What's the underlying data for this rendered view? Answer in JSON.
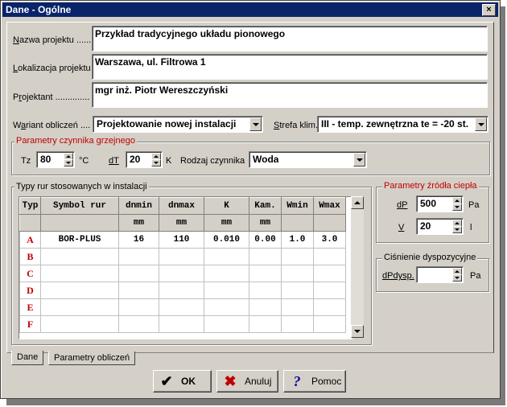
{
  "window": {
    "title": "Dane - Ogólne",
    "close": "×"
  },
  "fields": {
    "nazwa": {
      "label_u": "N",
      "label_rest": "azwa projektu ......",
      "value": "Przykład tradycyjnego układu pionowego"
    },
    "lokalizacja": {
      "label_u": "L",
      "label_rest": "okalizacja projektu",
      "value": "Warszawa, ul. Filtrowa 1"
    },
    "projektant": {
      "label_pre": "P",
      "label_u": "r",
      "label_rest": "ojektant ..............",
      "value": "mgr inż. Piotr Wereszczyński"
    },
    "wariant": {
      "label_pre": "W",
      "label_u": "a",
      "label_rest": "riant obliczeń ....",
      "value": "Projektowanie nowej instalacji"
    },
    "strefa": {
      "label_u": "S",
      "label_rest": "trefa klim.",
      "value": "III - temp. zewnętrzna te = -20 st."
    }
  },
  "czynnik": {
    "title": "Parametry czynnika grzejnego",
    "tz_label": "Tz",
    "tz_value": "80",
    "tz_unit": "°C",
    "dt_label": "dT",
    "dt_value": "20",
    "dt_unit": "K",
    "rodzaj_label": "Rodzaj czynnika",
    "rodzaj_value": "Woda"
  },
  "rury": {
    "title": "Typy rur stosowanych w instalacji",
    "headers": [
      "Typ",
      "Symbol rur",
      "dnmin",
      "dnmax",
      "K",
      "Kam.",
      "Wmin",
      "Wmax"
    ],
    "units": [
      "",
      "",
      "mm",
      "mm",
      "mm",
      "mm",
      "",
      ""
    ],
    "rows": [
      [
        "A",
        "BOR-PLUS",
        "16",
        "110",
        "0.010",
        "0.00",
        "1.0",
        "3.0"
      ],
      [
        "B",
        "",
        "",
        "",
        "",
        "",
        "",
        ""
      ],
      [
        "C",
        "",
        "",
        "",
        "",
        "",
        "",
        ""
      ],
      [
        "D",
        "",
        "",
        "",
        "",
        "",
        "",
        ""
      ],
      [
        "E",
        "",
        "",
        "",
        "",
        "",
        "",
        ""
      ],
      [
        "F",
        "",
        "",
        "",
        "",
        "",
        "",
        ""
      ]
    ]
  },
  "zrodlo": {
    "title": "Parametry źródła ciepła",
    "dp_label": "dP",
    "dp_value": "500",
    "dp_unit": "Pa",
    "v_label": "V",
    "v_value": "20",
    "v_unit": "l"
  },
  "cisnienie": {
    "title": "Ciśnienie dyspozycyjne",
    "label": "dPdysp.",
    "value": "",
    "unit": "Pa"
  },
  "tabs": [
    {
      "label": "Dane"
    },
    {
      "label": "Parametry obliczeń"
    }
  ],
  "buttons": {
    "ok": "OK",
    "anuluj": "Anuluj",
    "pomoc": "Pomoc"
  }
}
